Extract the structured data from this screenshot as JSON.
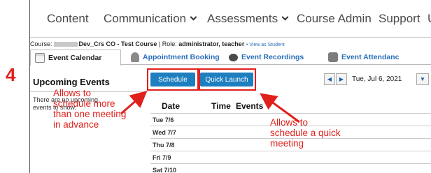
{
  "step_number": "4",
  "navbar": {
    "items": [
      {
        "label": "Content"
      },
      {
        "label": "Communication"
      },
      {
        "label": "Assessments"
      },
      {
        "label": "Course Admin"
      },
      {
        "label": "Support"
      },
      {
        "label": "UM"
      }
    ]
  },
  "course_info": {
    "prefix": "Course:",
    "course_name": "Dev_Crs CO - Test Course",
    "role_prefix": "| Role:",
    "role": "administrator, teacher",
    "view_as": "• View as Student"
  },
  "tabs": [
    {
      "label": "Event Calendar",
      "icon": "calendar-icon"
    },
    {
      "label": "Appointment Booking",
      "icon": "person-icon"
    },
    {
      "label": "Event Recordings",
      "icon": "recording-icon"
    },
    {
      "label": "Event Attendanc",
      "icon": "attendance-icon"
    }
  ],
  "left_panel": {
    "title": "Upcoming Events",
    "empty_text": "There are no upcoming events to show."
  },
  "toolbar": {
    "schedule_label": "Schedule",
    "quick_launch_label": "Quick Launch",
    "date_label": "Tue, Jul 6, 2021"
  },
  "table": {
    "headers": {
      "date": "Date",
      "time": "Time",
      "events": "Events"
    },
    "rows": [
      "Tue 7/6",
      "Wed 7/7",
      "Thu 7/8",
      "Fri 7/9",
      "Sat 7/10"
    ]
  },
  "annotations": {
    "left_note": "Allows to schedule more than one meeting in advance",
    "right_note": "Allows to schedule a quick meeting"
  },
  "colors": {
    "accent": "#e0201c",
    "button": "#1e7fc0",
    "link": "#2a6ebb"
  }
}
